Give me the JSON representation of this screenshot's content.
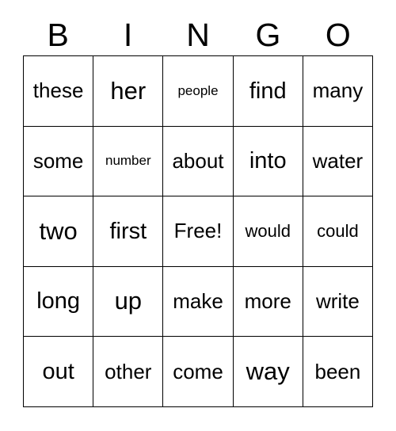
{
  "card": {
    "title": "BINGO",
    "background_color": "#ffffff",
    "text_color": "#000000",
    "border_color": "#000000",
    "columns": 5,
    "rows": 5
  },
  "header": {
    "letters": [
      "B",
      "I",
      "N",
      "G",
      "O"
    ]
  },
  "grid": {
    "rows": [
      [
        {
          "text": "these",
          "size": "md",
          "free": false
        },
        {
          "text": "her",
          "size": "xl",
          "free": false
        },
        {
          "text": "people",
          "size": "xs",
          "free": false
        },
        {
          "text": "find",
          "size": "lg",
          "free": false
        },
        {
          "text": "many",
          "size": "md",
          "free": false
        }
      ],
      [
        {
          "text": "some",
          "size": "md",
          "free": false
        },
        {
          "text": "number",
          "size": "xs",
          "free": false
        },
        {
          "text": "about",
          "size": "md",
          "free": false
        },
        {
          "text": "into",
          "size": "lg",
          "free": false
        },
        {
          "text": "water",
          "size": "md",
          "free": false
        }
      ],
      [
        {
          "text": "two",
          "size": "xl",
          "free": false
        },
        {
          "text": "first",
          "size": "lg",
          "free": false
        },
        {
          "text": "Free!",
          "size": "md",
          "free": true
        },
        {
          "text": "would",
          "size": "sm",
          "free": false
        },
        {
          "text": "could",
          "size": "sm",
          "free": false
        }
      ],
      [
        {
          "text": "long",
          "size": "lg",
          "free": false
        },
        {
          "text": "up",
          "size": "xl",
          "free": false
        },
        {
          "text": "make",
          "size": "md",
          "free": false
        },
        {
          "text": "more",
          "size": "md",
          "free": false
        },
        {
          "text": "write",
          "size": "md",
          "free": false
        }
      ],
      [
        {
          "text": "out",
          "size": "lg",
          "free": false
        },
        {
          "text": "other",
          "size": "md",
          "free": false
        },
        {
          "text": "come",
          "size": "md",
          "free": false
        },
        {
          "text": "way",
          "size": "xl",
          "free": false
        },
        {
          "text": "been",
          "size": "md",
          "free": false
        }
      ]
    ]
  }
}
